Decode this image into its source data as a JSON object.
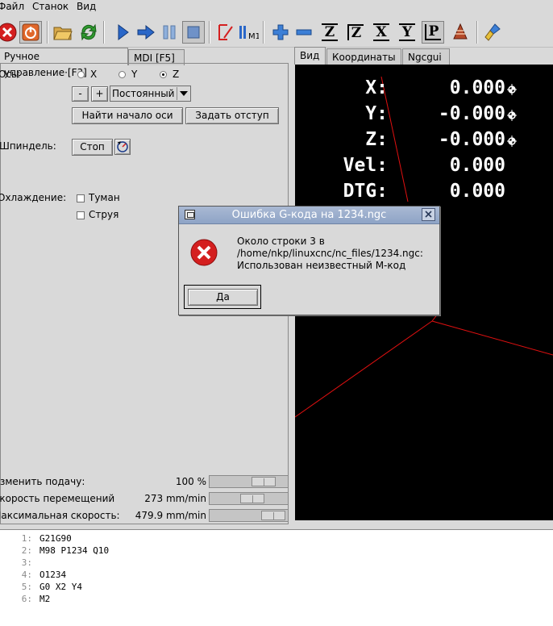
{
  "menubar": {
    "items": [
      "Файл",
      "Станок",
      "Вид"
    ]
  },
  "toolbar": {
    "buttons": [
      "estop-icon",
      "power-icon",
      "open-file-icon",
      "reload-icon",
      "run-icon",
      "step-icon",
      "pause-icon",
      "stop-icon",
      "block-delete-icon",
      "optional-stop-icon",
      "zoom-in-icon",
      "zoom-out-icon",
      "view-z-icon",
      "view-z2-icon",
      "view-x-icon",
      "view-y-icon",
      "view-p-icon",
      "rotate-icon",
      "clear-plot-icon"
    ],
    "axis_labels": {
      "z": "Z",
      "z2": "Z",
      "x": "X",
      "y": "Y",
      "p": "P"
    },
    "optional_stop_label": "M1"
  },
  "left_tabs": {
    "manual": "Ручное управление·[F3]",
    "mdi": "MDI [F5]"
  },
  "right_tabs": {
    "view": "Вид",
    "coords": "Координаты",
    "ngcgui": "Ngcgui"
  },
  "manual": {
    "axis_label": "Ось:",
    "axes": [
      {
        "label": "X",
        "selected": false
      },
      {
        "label": "Y",
        "selected": false
      },
      {
        "label": "Z",
        "selected": true
      }
    ],
    "minus": "-",
    "plus": "+",
    "jog_mode": "Постоянный",
    "home_button": "Найти начало оси",
    "offset_button": "Задать отступ",
    "spindle_label": "Шпиндель:",
    "spindle_stop": "Стоп",
    "coolant_label": "Охлаждение:",
    "mist": "Туман",
    "flood": "Струя"
  },
  "overrides": {
    "feed_label": "Изменить подачу:",
    "feed_value": "100 %",
    "feed_fraction": 0.77,
    "jog_label": "Скорость перемещений",
    "jog_value": "273 mm/min",
    "jog_fraction": 0.57,
    "max_label": "Максимальная скорость:",
    "max_value": "479.9 mm/min",
    "max_fraction": 0.95
  },
  "dro": [
    {
      "axis": "X:",
      "value": "0.000",
      "homed": true
    },
    {
      "axis": "Y:",
      "value": "-0.000",
      "homed": true
    },
    {
      "axis": "Z:",
      "value": "-0.000",
      "homed": true
    },
    {
      "axis": "Vel:",
      "value": "0.000",
      "homed": false
    },
    {
      "axis": "DTG:",
      "value": "0.000",
      "homed": false
    }
  ],
  "gcode": [
    {
      "num": "1:",
      "text": "G21G90"
    },
    {
      "num": "2:",
      "text": "M98 P1234 Q10"
    },
    {
      "num": "3:",
      "text": ""
    },
    {
      "num": "4:",
      "text": "O1234"
    },
    {
      "num": "5:",
      "text": "G0 X2 Y4"
    },
    {
      "num": "6:",
      "text": "M2"
    }
  ],
  "dialog": {
    "title": "Ошибка G-кода на 1234.ngc",
    "line1": "Около строки 3 в",
    "line2": "/home/nkp/linuxcnc/nc_files/1234.ngc:",
    "line3": "Использован неизвестный M-код",
    "ok": "Да"
  },
  "colors": {
    "preview_bg": "#000000",
    "toolpath": "#e01010",
    "dro_text": "#ffffff",
    "estop_red": "#d41f1f",
    "run_blue": "#2a67c8"
  }
}
